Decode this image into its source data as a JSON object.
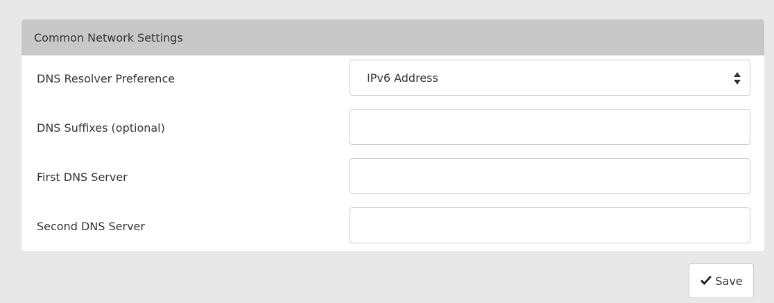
{
  "panel": {
    "title": "Common Network Settings"
  },
  "fields": [
    {
      "label": "DNS Resolver Preference",
      "type": "select",
      "value": "IPv6 Address"
    },
    {
      "label": "DNS Suffixes (optional)",
      "type": "text",
      "value": "",
      "placeholder": ""
    },
    {
      "label": "First DNS Server",
      "type": "text",
      "value": "",
      "placeholder": ""
    },
    {
      "label": "Second DNS Server",
      "type": "text",
      "value": "",
      "placeholder": ""
    }
  ],
  "actions": {
    "save_label": "Save"
  },
  "icons": {
    "select_arrows": "sort-arrows-icon",
    "save": "checkmark-icon"
  },
  "colors": {
    "page_background": "#e8e8e8",
    "panel_heading": "#c8c8c8",
    "panel_body": "#ffffff",
    "text": "#333333",
    "border": "#cccccc"
  }
}
